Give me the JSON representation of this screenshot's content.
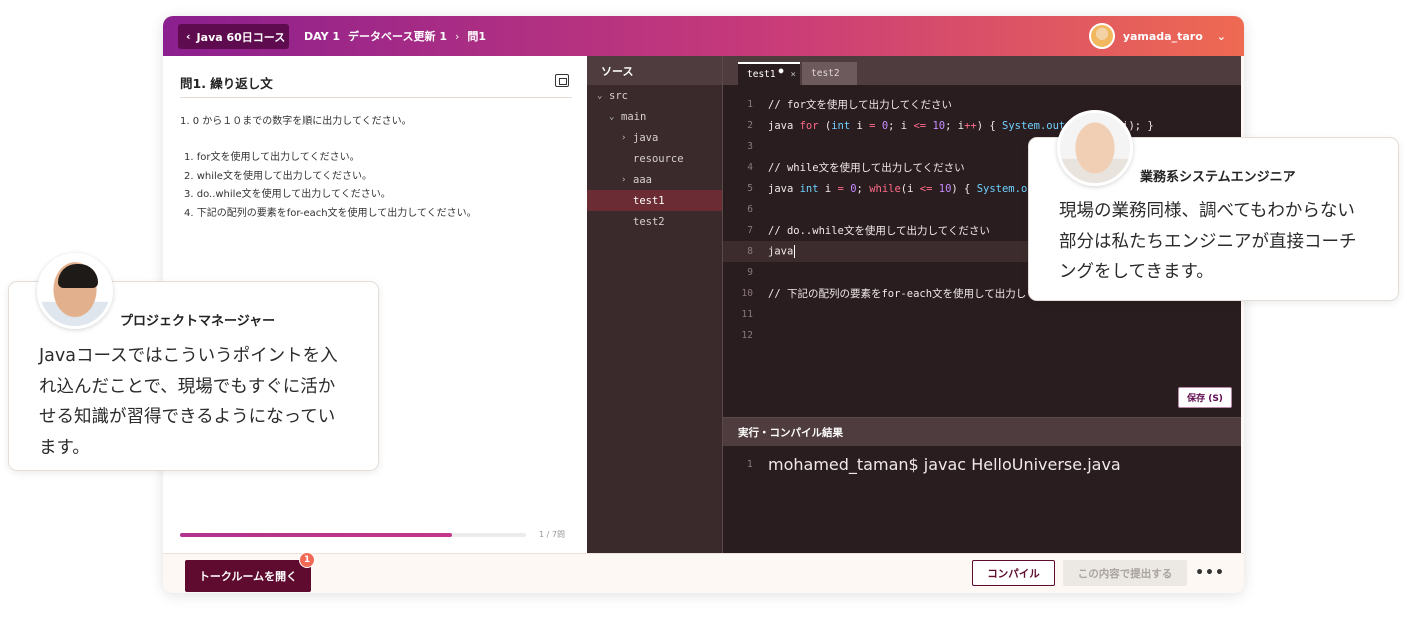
{
  "topbar": {
    "back_label": "Java 60日コース",
    "crumbs": [
      "DAY 1",
      "データベース更新 1",
      "問1"
    ],
    "username": "yamada_taro"
  },
  "question": {
    "title": "問1.  繰り返し文",
    "intro": "1. 0 から１０までの数字を順に出力してください。",
    "items": [
      "1. for文を使用して出力してください。",
      "2. while文を使用して出力してください。",
      "3. do..while文を使用して出力してください。",
      "4. 下記の配列の要素をfor-each文を使用して出力してください。"
    ],
    "progress_fraction": 0.785,
    "progress_label": "1 / 7問"
  },
  "filetree": {
    "header": "ソース",
    "items": [
      {
        "label": "src",
        "arrow": "⌄"
      },
      {
        "label": "main",
        "arrow": "⌄"
      },
      {
        "label": "java",
        "arrow": "›"
      },
      {
        "label": "resource",
        "arrow": ""
      },
      {
        "label": "aaa",
        "arrow": "›"
      },
      {
        "label": "test1",
        "arrow": ""
      },
      {
        "label": "test2",
        "arrow": ""
      }
    ],
    "active_item": "test1"
  },
  "editor": {
    "tabs": [
      {
        "label": "test1",
        "modified": "●",
        "close": "×"
      },
      {
        "label": "test2"
      }
    ],
    "line_numbers": [
      "1",
      "2",
      "3",
      "4",
      "5",
      "6",
      "7",
      "8",
      "9",
      "10",
      "11",
      "12"
    ],
    "lines": {
      "l1": "// for文を使用して出力してください",
      "l2": {
        "a": "java ",
        "b": "for",
        "c": " (",
        "d": "int",
        "e": " i ",
        "f": "=",
        "g": " ",
        "h": "0",
        "i": "; i ",
        "j": "<=",
        "k": " ",
        "l": "10",
        "m": "; i",
        "n": "++",
        "o": ") { ",
        "p": "System.out",
        "q": ".println(i); }"
      },
      "l4": "// while文を使用して出力してください",
      "l5": {
        "a": "java ",
        "b": "int",
        "c": " i ",
        "d": "=",
        "e": " ",
        "f": "0",
        "g": "; ",
        "h": "while",
        "i": "(i ",
        "j": "<=",
        "k": " ",
        "l": "10",
        "m": ") { ",
        "n": "System.out"
      },
      "l7": "// do..while文を使用して出力してください",
      "l8": "java",
      "l10": "// 下記の配列の要素をfor-each文を使用して出力し"
    },
    "save_label": "保存 (S)"
  },
  "result": {
    "header": "実行・コンパイル結果",
    "line_number": "1",
    "output": "mohamed_taman$ javac HelloUniverse.java"
  },
  "footer": {
    "talk_label": "トークルームを開く",
    "talk_badge": "1",
    "compile_label": "コンパイル",
    "submit_label": "この内容で提出する",
    "more_label": "•••"
  },
  "cards": {
    "pm": {
      "role": "プロジェクトマネージャー",
      "lines": [
        "Javaコースではこういうポイントを入",
        "れ込んだことで、現場でもすぐに活か",
        "せる知識が習得できるようになってい",
        "ます。"
      ]
    },
    "se": {
      "role": "業務系システムエンジニア",
      "lines": [
        "現場の業務同様、調べてもわからない",
        "部分は私たちエンジニアが直接コーチ",
        "ングをしてきます。"
      ]
    }
  },
  "colors": {
    "brand_dark": "#5e0b2f",
    "gradient_start": "#8b1f8f",
    "gradient_end": "#ef6a52",
    "editor_bg": "#2a1d1f",
    "accent_badge": "#f26a55"
  }
}
